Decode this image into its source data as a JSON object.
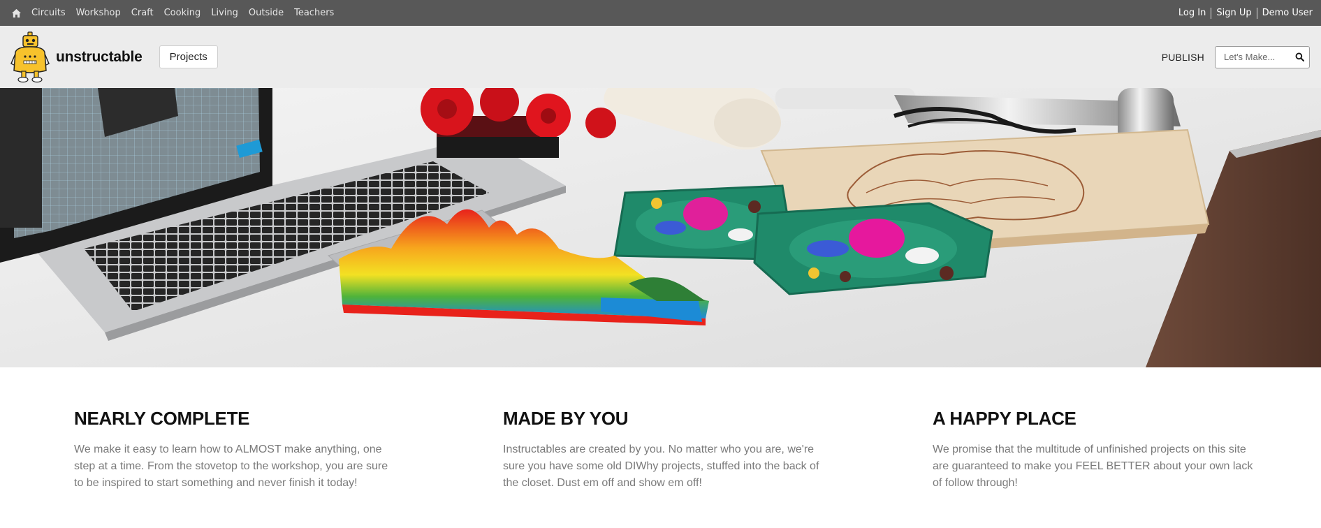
{
  "topnav": {
    "home_icon": "home-icon",
    "links": [
      "Circuits",
      "Workshop",
      "Craft",
      "Cooking",
      "Living",
      "Outside",
      "Teachers"
    ],
    "login": "Log In",
    "signup": "Sign Up",
    "user": "Demo User"
  },
  "header": {
    "logo_icon": "robot-mascot-icon",
    "brand": "unstructable",
    "projects_button": "Projects",
    "publish": "PUBLISH",
    "search_placeholder": "Let's Make...",
    "search_icon": "search-icon"
  },
  "hero": {
    "image": "desk-with-laptop-and-3d-printed-projects"
  },
  "features": [
    {
      "title": "NEARLY COMPLETE",
      "text": "We make it easy to learn how to ALMOST make anything, one step at a time. From the stovetop to the workshop, you are sure to be inspired to start something and never finish it today!"
    },
    {
      "title": "MADE BY YOU",
      "text": "Instructables are created by you. No matter who you are, we're sure you have some old DIWhy projects, stuffed into the back of the closet. Dust em off and show em off!"
    },
    {
      "title": "A HAPPY PLACE",
      "text": "We promise that the multitude of unfinished projects on this site are guaranteed to make you FEEL BETTER about your own lack of follow through!"
    }
  ],
  "colors": {
    "topbar": "#585858",
    "header": "#ececec",
    "mascot": "#f7c22c",
    "feature_text": "#7a7a7a"
  }
}
